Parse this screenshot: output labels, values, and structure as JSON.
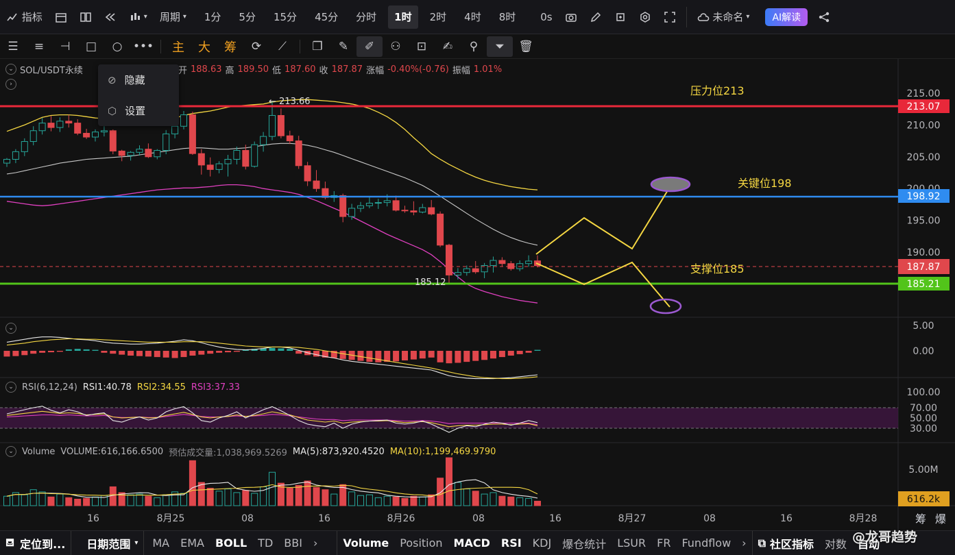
{
  "topbar": {
    "indicators": "指标",
    "period": "周期",
    "intervals": [
      "1分",
      "5分",
      "15分",
      "45分",
      "分时",
      "1时",
      "2时",
      "4时",
      "8时"
    ],
    "active_interval": "1时",
    "timer": "0s",
    "layout_name": "未命名",
    "ai_button": "AI解读"
  },
  "drawbar": {
    "tabs": [
      "主",
      "大",
      "筹"
    ]
  },
  "legend": {
    "symbol": "SOL/USDT永续",
    "open_label": "开",
    "open": "188.63",
    "high_label": "高",
    "high": "189.50",
    "low_label": "低",
    "low": "187.60",
    "close_label": "收",
    "close": "187.87",
    "chg_label": "涨幅",
    "chg": "-0.40%(-0.76)",
    "amp_label": "振幅",
    "amp": "1.01%"
  },
  "popup": {
    "hide": "隐藏",
    "settings": "设置"
  },
  "rsi_legend": {
    "name": "RSI(6,12,24)",
    "rsi1": "RSI1:40.78",
    "rsi2": "RSI2:34.55",
    "rsi3": "RSI3:37.33"
  },
  "vol_legend": {
    "name": "Volume",
    "volume": "VOLUME:616,166.6500",
    "est": "预估成交量:1,038,969.5269",
    "ma5": "MA(5):873,920.4520",
    "ma10": "MA(10):1,199,469.9790"
  },
  "annotations": {
    "resistance": "压力位213",
    "key": "关键位198",
    "support": "支撑位185",
    "high_mark": "← 213.66",
    "low_mark": "185.12"
  },
  "price_axis": {
    "ticks": [
      "215.00",
      "210.00",
      "205.00",
      "200.00",
      "195.00",
      "190.00"
    ],
    "tags": {
      "resistance": "213.07",
      "key": "198.92",
      "last": "187.87",
      "support": "185.21"
    }
  },
  "macd_axis": [
    "5.00",
    "0.00"
  ],
  "rsi_axis": [
    "100.00",
    "70.00",
    "50.00",
    "30.00"
  ],
  "vol_axis": {
    "tick": "5.00M",
    "last": "616.2k"
  },
  "time_axis": [
    "16",
    "8月25",
    "08",
    "16",
    "8月26",
    "08",
    "16",
    "8月27",
    "08",
    "16",
    "8月28"
  ],
  "time_corner": [
    "筹",
    "爆"
  ],
  "bottombar": {
    "locate": "定位到...",
    "range": "日期范围",
    "left_items": [
      "MA",
      "EMA",
      "BOLL",
      "TD",
      "BBI"
    ],
    "right_items": [
      "Volume",
      "Position",
      "MACD",
      "RSI",
      "KDJ",
      "爆仓统计",
      "LSUR",
      "FR",
      "Fundflow"
    ],
    "community": "社区指标",
    "tail": "对数",
    "auto": "自动",
    "watermark": "@龙哥趋势"
  },
  "colors": {
    "up": "#26a69a",
    "down": "#e0474c",
    "resistance": "#e8283a",
    "key": "#2f8cf0",
    "support": "#52c41a",
    "yellow": "#f5d742",
    "purple": "#9b59d0"
  },
  "chart_data": {
    "type": "candlestick",
    "title": "SOL/USDT永续 1时",
    "ohlc": [
      [
        204.0,
        204.8,
        203.4,
        204.6
      ],
      [
        204.6,
        206.2,
        204.0,
        205.8
      ],
      [
        205.8,
        207.9,
        205.1,
        207.4
      ],
      [
        207.4,
        209.8,
        206.8,
        209.1
      ],
      [
        209.1,
        211.1,
        208.5,
        210.3
      ],
      [
        210.3,
        211.4,
        209.0,
        209.6
      ],
      [
        209.6,
        211.2,
        208.9,
        210.6
      ],
      [
        210.6,
        211.6,
        209.6,
        210.3
      ],
      [
        210.3,
        210.9,
        208.4,
        208.7
      ],
      [
        208.7,
        209.4,
        207.8,
        208.1
      ],
      [
        208.1,
        209.3,
        207.4,
        208.9
      ],
      [
        208.9,
        209.8,
        208.2,
        209.1
      ],
      [
        209.1,
        209.3,
        205.4,
        205.9
      ],
      [
        205.9,
        206.1,
        204.3,
        205.2
      ],
      [
        205.2,
        205.9,
        204.4,
        205.7
      ],
      [
        205.7,
        206.8,
        205.2,
        206.2
      ],
      [
        206.2,
        207.1,
        204.8,
        205.0
      ],
      [
        205.0,
        206.2,
        204.6,
        206.0
      ],
      [
        206.0,
        209.2,
        205.4,
        208.6
      ],
      [
        208.6,
        210.4,
        207.9,
        209.8
      ],
      [
        209.8,
        212.2,
        209.3,
        211.6
      ],
      [
        211.6,
        212.1,
        205.3,
        205.5
      ],
      [
        205.5,
        206.2,
        202.2,
        203.7
      ],
      [
        203.7,
        204.9,
        201.9,
        203.0
      ],
      [
        203.0,
        204.3,
        202.4,
        203.9
      ],
      [
        203.9,
        205.3,
        201.9,
        204.6
      ],
      [
        204.6,
        206.6,
        203.8,
        206.0
      ],
      [
        206.0,
        206.9,
        203.0,
        203.5
      ],
      [
        203.5,
        207.4,
        203.3,
        206.9
      ],
      [
        206.9,
        208.9,
        205.8,
        208.2
      ],
      [
        208.2,
        213.66,
        207.6,
        211.5
      ],
      [
        211.5,
        212.6,
        207.9,
        208.3
      ],
      [
        208.3,
        209.1,
        207.0,
        207.5
      ],
      [
        207.5,
        208.3,
        203.1,
        203.6
      ],
      [
        203.6,
        204.2,
        200.4,
        201.2
      ],
      [
        201.2,
        202.9,
        199.5,
        200.0
      ],
      [
        200.0,
        201.1,
        198.3,
        198.6
      ],
      [
        198.6,
        199.6,
        197.9,
        198.9
      ],
      [
        198.9,
        199.2,
        194.7,
        195.6
      ],
      [
        195.6,
        197.6,
        195.1,
        196.9
      ],
      [
        196.9,
        197.9,
        196.3,
        197.3
      ],
      [
        197.3,
        198.8,
        196.9,
        197.7
      ],
      [
        197.7,
        198.4,
        196.8,
        197.8
      ],
      [
        197.8,
        199.1,
        197.2,
        198.1
      ],
      [
        198.1,
        198.9,
        196.4,
        196.6
      ],
      [
        196.6,
        197.3,
        196.2,
        196.5
      ],
      [
        196.5,
        198.0,
        195.8,
        196.3
      ],
      [
        196.3,
        197.6,
        196.1,
        197.0
      ],
      [
        197.0,
        198.2,
        195.8,
        196.0
      ],
      [
        196.0,
        196.4,
        190.8,
        191.1
      ],
      [
        191.1,
        191.3,
        185.12,
        186.4
      ],
      [
        186.4,
        187.5,
        185.7,
        186.8
      ],
      [
        186.8,
        187.9,
        186.3,
        187.4
      ],
      [
        187.4,
        188.6,
        186.6,
        186.9
      ],
      [
        186.9,
        188.3,
        185.9,
        187.9
      ],
      [
        187.9,
        189.3,
        186.8,
        188.7
      ],
      [
        188.7,
        189.2,
        187.8,
        188.2
      ],
      [
        188.2,
        188.6,
        187.1,
        187.4
      ],
      [
        187.4,
        188.7,
        187.0,
        188.2
      ],
      [
        188.2,
        189.5,
        187.7,
        188.6
      ],
      [
        188.63,
        189.5,
        187.6,
        187.87
      ]
    ],
    "levels": {
      "resistance": 213.07,
      "key": 198.92,
      "support": 185.21
    },
    "ylim": [
      178,
      218
    ],
    "ma_slow": [
      202.3,
      202.5,
      202.8,
      203.1,
      203.4,
      203.7,
      204.0,
      204.2,
      204.4,
      204.6,
      204.7,
      204.8,
      204.9,
      205.0,
      205.1,
      205.3,
      205.5,
      205.7,
      205.9,
      206.1,
      206.3,
      206.4,
      206.4,
      206.3,
      206.2,
      206.2,
      206.3,
      206.4,
      206.6,
      206.8,
      207.0,
      207.1,
      207.1,
      207.0,
      206.8,
      206.5,
      206.1,
      205.7,
      205.2,
      204.7,
      204.2,
      203.7,
      203.2,
      202.7,
      202.2,
      201.7,
      201.1,
      200.5,
      199.7,
      198.8,
      197.9,
      197.0,
      196.1,
      195.2,
      194.4,
      193.6,
      192.9,
      192.3,
      191.8,
      191.4,
      191.1
    ],
    "bb_upper": [
      209.0,
      209.5,
      210.0,
      210.6,
      211.2,
      211.5,
      211.6,
      211.6,
      211.5,
      211.3,
      211.1,
      211.0,
      210.8,
      210.6,
      210.5,
      210.5,
      210.6,
      210.7,
      210.9,
      211.1,
      211.5,
      211.8,
      212.0,
      212.2,
      212.5,
      212.8,
      213.0,
      213.1,
      213.2,
      213.3,
      213.6,
      213.8,
      213.9,
      214.0,
      214.0,
      213.9,
      213.8,
      213.7,
      213.5,
      213.3,
      213.0,
      212.6,
      212.0,
      211.3,
      210.4,
      209.3,
      208.0,
      206.8,
      205.5,
      204.6,
      203.8,
      203.1,
      202.4,
      201.8,
      201.3,
      200.9,
      200.6,
      200.3,
      200.1,
      199.9,
      199.8
    ],
    "bb_lower": [
      198.0,
      197.8,
      197.6,
      197.4,
      197.3,
      197.4,
      197.6,
      197.8,
      198.0,
      198.2,
      198.4,
      198.6,
      198.8,
      199.0,
      199.2,
      199.4,
      199.6,
      199.8,
      199.9,
      200.0,
      200.1,
      200.1,
      200.2,
      200.3,
      200.5,
      200.6,
      200.6,
      200.5,
      200.3,
      200.0,
      199.8,
      199.6,
      199.4,
      199.1,
      198.6,
      198.1,
      197.5,
      196.9,
      196.3,
      195.6,
      194.9,
      194.2,
      193.5,
      192.8,
      192.2,
      191.6,
      191.0,
      190.4,
      189.6,
      188.5,
      187.3,
      186.1,
      185.0,
      184.3,
      183.8,
      183.4,
      183.0,
      182.7,
      182.4,
      182.2,
      182.0
    ],
    "macd_hist": [
      -1.2,
      -1.1,
      -0.9,
      -0.6,
      -0.4,
      -0.3,
      -0.2,
      0.3,
      0.4,
      0.3,
      0.2,
      -0.4,
      -0.6,
      -0.8,
      -1.0,
      -1.1,
      -1.2,
      -1.3,
      -1.4,
      -1.5,
      -1.3,
      -1.0,
      -0.8,
      -0.6,
      -0.4,
      -0.3,
      -0.2,
      0.2,
      0.4,
      0.5,
      0.6,
      0.5,
      0.4,
      -0.6,
      -0.9,
      -1.2,
      -1.4,
      -1.5,
      -1.7,
      -1.9,
      -2.1,
      -2.3,
      -2.4,
      -2.3,
      -2.2,
      -2.0,
      -1.8,
      -1.6,
      -1.4,
      -2.4,
      -2.6,
      -2.5,
      -2.3,
      -2.1,
      -1.9,
      -1.6,
      -1.3,
      -1.0,
      -0.7,
      -0.4,
      0.2
    ],
    "macd_dif": [
      1.8,
      2.1,
      2.4,
      2.7,
      2.9,
      2.9,
      2.8,
      2.6,
      2.4,
      2.3,
      2.1,
      1.8,
      1.6,
      1.5,
      1.4,
      1.4,
      1.5,
      1.6,
      1.8,
      2.0,
      2.3,
      2.1,
      1.7,
      1.2,
      0.8,
      0.5,
      0.3,
      0.2,
      0.3,
      0.5,
      0.8,
      0.8,
      0.6,
      0.1,
      -0.4,
      -0.8,
      -1.2,
      -1.5,
      -1.9,
      -2.2,
      -2.4,
      -2.6,
      -2.8,
      -3.0,
      -3.2,
      -3.4,
      -3.6,
      -3.8,
      -4.0,
      -4.6,
      -5.2,
      -5.5,
      -5.7,
      -5.8,
      -5.8,
      -5.8,
      -5.7,
      -5.6,
      -5.4,
      -5.2,
      -5.0
    ],
    "macd_dea": [
      1.2,
      1.4,
      1.6,
      1.9,
      2.1,
      2.3,
      2.4,
      2.5,
      2.5,
      2.4,
      2.4,
      2.3,
      2.2,
      2.1,
      2.0,
      1.9,
      1.8,
      1.8,
      1.8,
      1.8,
      1.9,
      1.9,
      1.9,
      1.8,
      1.6,
      1.4,
      1.2,
      1.0,
      0.9,
      0.8,
      0.8,
      0.8,
      0.8,
      0.7,
      0.5,
      0.3,
      0.0,
      -0.3,
      -0.6,
      -0.9,
      -1.2,
      -1.5,
      -1.8,
      -2.1,
      -2.4,
      -2.7,
      -3.0,
      -3.3,
      -3.6,
      -4.0,
      -4.4,
      -4.8,
      -5.1,
      -5.4,
      -5.6,
      -5.7,
      -5.8,
      -5.8,
      -5.7,
      -5.6,
      -5.4
    ],
    "rsi1": [
      58,
      62,
      66,
      70,
      73,
      65,
      60,
      66,
      62,
      55,
      58,
      60,
      45,
      42,
      48,
      52,
      46,
      50,
      62,
      68,
      72,
      60,
      45,
      42,
      50,
      55,
      62,
      50,
      58,
      66,
      72,
      64,
      55,
      45,
      38,
      35,
      33,
      40,
      30,
      38,
      42,
      44,
      45,
      46,
      40,
      38,
      40,
      44,
      38,
      30,
      22,
      30,
      35,
      33,
      38,
      42,
      40,
      36,
      40,
      45,
      41
    ],
    "rsi2": [
      55,
      57,
      59,
      61,
      63,
      61,
      59,
      60,
      59,
      56,
      57,
      58,
      52,
      50,
      51,
      52,
      50,
      51,
      55,
      58,
      61,
      57,
      52,
      50,
      52,
      53,
      56,
      53,
      55,
      58,
      62,
      59,
      56,
      51,
      46,
      44,
      42,
      44,
      40,
      42,
      43,
      44,
      44,
      45,
      43,
      41,
      42,
      43,
      41,
      37,
      33,
      35,
      36,
      36,
      37,
      38,
      38,
      37,
      38,
      39,
      35
    ],
    "rsi3": [
      52,
      53,
      54,
      55,
      56,
      56,
      55,
      56,
      55,
      54,
      54,
      55,
      52,
      51,
      51,
      52,
      51,
      51,
      53,
      55,
      57,
      55,
      53,
      52,
      52,
      53,
      54,
      53,
      54,
      55,
      57,
      56,
      54,
      52,
      50,
      48,
      47,
      47,
      45,
      46,
      46,
      46,
      46,
      46,
      45,
      44,
      44,
      45,
      44,
      42,
      39,
      40,
      40,
      40,
      40,
      40,
      40,
      40,
      40,
      40,
      37
    ],
    "volume": [
      1.3,
      1.8,
      1.5,
      2.2,
      1.9,
      1.2,
      1.6,
      1.1,
      0.9,
      1.0,
      1.2,
      1.4,
      2.6,
      1.8,
      1.5,
      1.6,
      1.3,
      1.1,
      1.5,
      1.9,
      1.7,
      6.2,
      3.2,
      2.4,
      2.0,
      2.3,
      1.8,
      2.1,
      1.7,
      2.6,
      4.6,
      3.1,
      2.4,
      2.8,
      3.4,
      2.5,
      2.2,
      1.6,
      2.9,
      1.9,
      1.4,
      1.5,
      1.1,
      1.3,
      1.2,
      1.0,
      1.3,
      1.2,
      1.5,
      3.8,
      6.6,
      3.2,
      2.3,
      2.0,
      1.6,
      1.8,
      1.3,
      1.2,
      1.1,
      1.0,
      0.62
    ],
    "vol_ylim": [
      0,
      7
    ]
  }
}
